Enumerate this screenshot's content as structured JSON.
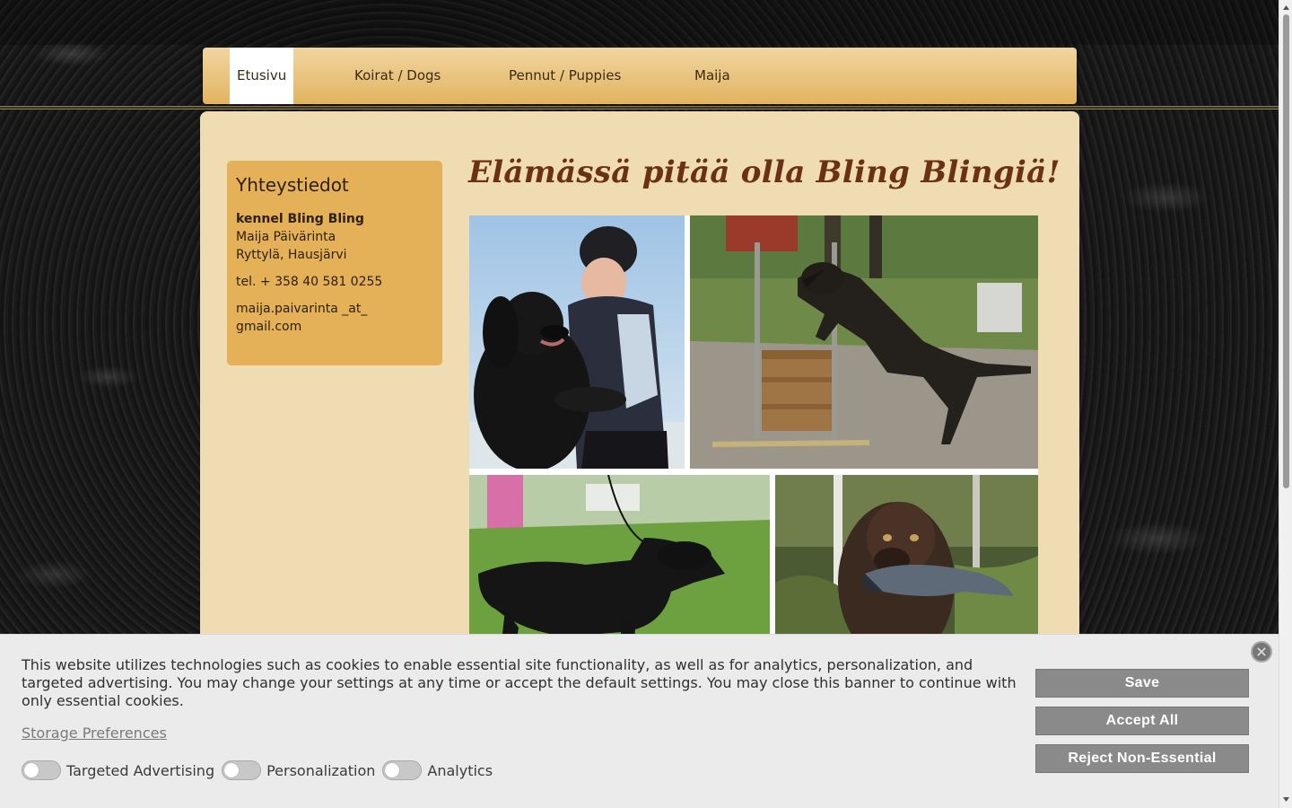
{
  "nav": {
    "items": [
      {
        "label": "Etusivu",
        "active": true
      },
      {
        "label": "Koirat / Dogs",
        "active": false
      },
      {
        "label": "Pennut / Puppies",
        "active": false
      },
      {
        "label": "Maija",
        "active": false
      }
    ]
  },
  "contact": {
    "title": "Yhteystiedot",
    "kennel": "kennel Bling Bling",
    "name": "Maija Päivärinta",
    "location": "Ryttylä, Hausjärvi",
    "phone": "tel. + 358 40 581 0255",
    "email_line1": "maija.paivarinta _at_",
    "email_line2": "gmail.com"
  },
  "headline": "Elämässä pitää olla Bling Blingiä!",
  "photos": [
    {
      "icon": "woman-with-dog-photo"
    },
    {
      "icon": "dog-jumping-photo"
    },
    {
      "icon": "dog-show-photo"
    },
    {
      "icon": "dog-retrieving-bird-photo"
    }
  ],
  "cookie": {
    "text": "This website utilizes technologies such as cookies to enable essential site functionality, as well as for analytics, personalization, and targeted advertising. You may change your settings at any time or accept the default settings. You may close this banner to continue with only essential cookies.",
    "preferences_link": "Storage Preferences",
    "toggles": [
      {
        "label": "Targeted Advertising",
        "on": false
      },
      {
        "label": "Personalization",
        "on": false
      },
      {
        "label": "Analytics",
        "on": false
      }
    ],
    "buttons": {
      "save": "Save",
      "accept_all": "Accept All",
      "reject": "Reject Non-Essential"
    }
  },
  "colors": {
    "nav_gradient_top": "#f1d6a0",
    "nav_gradient_bottom": "#e2b360",
    "content_bg": "#efdcb2",
    "contact_bg": "#e4b158",
    "headline": "#6b3212",
    "button_bg": "#8a8a8a"
  }
}
